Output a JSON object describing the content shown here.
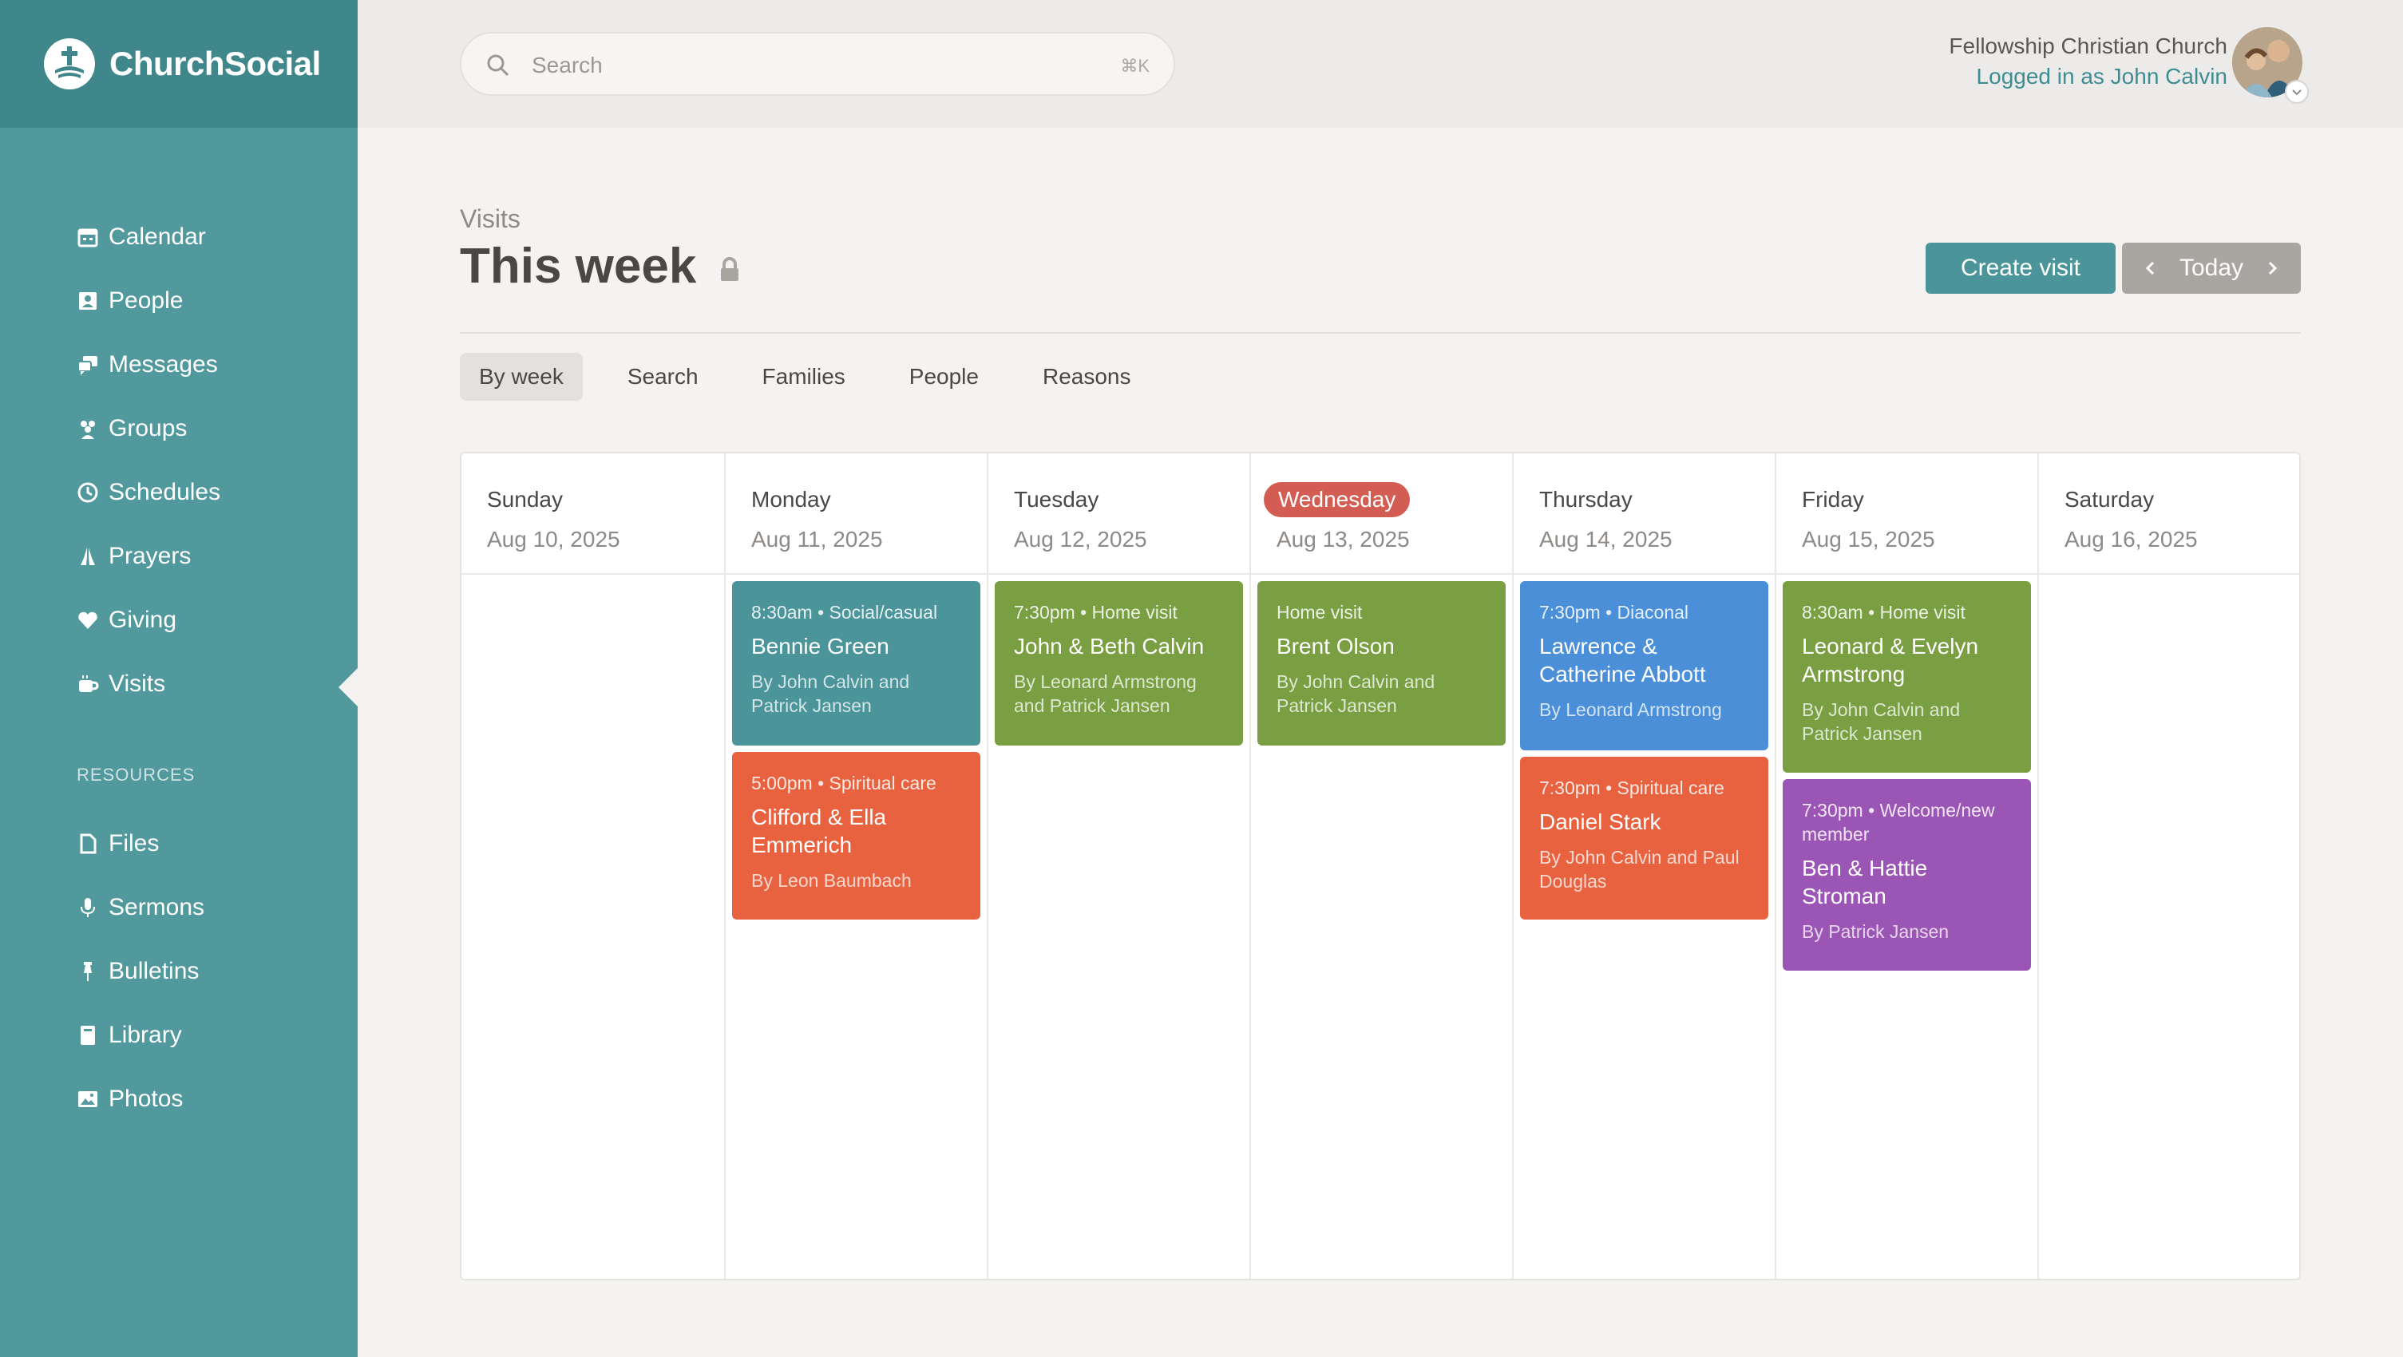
{
  "brand": {
    "name": "ChurchSocial"
  },
  "nav": {
    "items": [
      {
        "label": "Calendar",
        "icon": "calendar-icon"
      },
      {
        "label": "People",
        "icon": "people-icon"
      },
      {
        "label": "Messages",
        "icon": "messages-icon"
      },
      {
        "label": "Groups",
        "icon": "groups-icon"
      },
      {
        "label": "Schedules",
        "icon": "clock-icon"
      },
      {
        "label": "Prayers",
        "icon": "praying-hands-icon"
      },
      {
        "label": "Giving",
        "icon": "heart-icon"
      },
      {
        "label": "Visits",
        "icon": "coffee-icon",
        "active": true
      }
    ],
    "section_label": "RESOURCES",
    "resources": [
      {
        "label": "Files",
        "icon": "file-icon"
      },
      {
        "label": "Sermons",
        "icon": "microphone-icon"
      },
      {
        "label": "Bulletins",
        "icon": "pin-icon"
      },
      {
        "label": "Library",
        "icon": "book-icon"
      },
      {
        "label": "Photos",
        "icon": "photo-icon"
      }
    ]
  },
  "search": {
    "placeholder": "Search",
    "shortcut": "⌘K"
  },
  "account": {
    "org": "Fellowship Christian Church",
    "user": "Logged in as John Calvin"
  },
  "page": {
    "breadcrumb": "Visits",
    "title": "This week",
    "create_label": "Create visit",
    "today_label": "Today"
  },
  "tabs": [
    {
      "label": "By week",
      "active": true
    },
    {
      "label": "Search"
    },
    {
      "label": "Families"
    },
    {
      "label": "People"
    },
    {
      "label": "Reasons"
    }
  ],
  "colors": {
    "teal": "#4b959a",
    "orange": "#e8623f",
    "green": "#7a9f43",
    "blue": "#4a8fd8",
    "purple": "#9b56b5",
    "today": "#d35d52"
  },
  "calendar": {
    "days": [
      {
        "name": "Sunday",
        "date": "Aug 10, 2025",
        "events": []
      },
      {
        "name": "Monday",
        "date": "Aug 11, 2025",
        "events": [
          {
            "meta": "8:30am • Social/casual",
            "title": "Bennie Green",
            "by": "By John Calvin and Patrick Jansen",
            "color": "teal"
          },
          {
            "meta": "5:00pm • Spiritual care",
            "title": "Clifford & Ella Emmerich",
            "by": "By Leon Baumbach",
            "color": "orange"
          }
        ]
      },
      {
        "name": "Tuesday",
        "date": "Aug 12, 2025",
        "events": [
          {
            "meta": "7:30pm • Home visit",
            "title": "John & Beth Calvin",
            "by": "By Leonard Armstrong and Patrick Jansen",
            "color": "green"
          }
        ]
      },
      {
        "name": "Wednesday",
        "date": "Aug 13, 2025",
        "today": true,
        "events": [
          {
            "meta": "Home visit",
            "title": "Brent Olson",
            "by": "By John Calvin and Patrick Jansen",
            "color": "green"
          }
        ]
      },
      {
        "name": "Thursday",
        "date": "Aug 14, 2025",
        "events": [
          {
            "meta": "7:30pm • Diaconal",
            "title": "Lawrence & Catherine Abbott",
            "by": "By Leonard Armstrong",
            "color": "blue"
          },
          {
            "meta": "7:30pm • Spiritual care",
            "title": "Daniel Stark",
            "by": "By John Calvin and Paul Douglas",
            "color": "orange"
          }
        ]
      },
      {
        "name": "Friday",
        "date": "Aug 15, 2025",
        "events": [
          {
            "meta": "8:30am • Home visit",
            "title": "Leonard & Evelyn Armstrong",
            "by": "By John Calvin and Patrick Jansen",
            "color": "green"
          },
          {
            "meta": "7:30pm • Welcome/new member",
            "title": "Ben & Hattie Stroman",
            "by": "By Patrick Jansen",
            "color": "purple"
          }
        ]
      },
      {
        "name": "Saturday",
        "date": "Aug 16, 2025",
        "events": []
      }
    ]
  }
}
